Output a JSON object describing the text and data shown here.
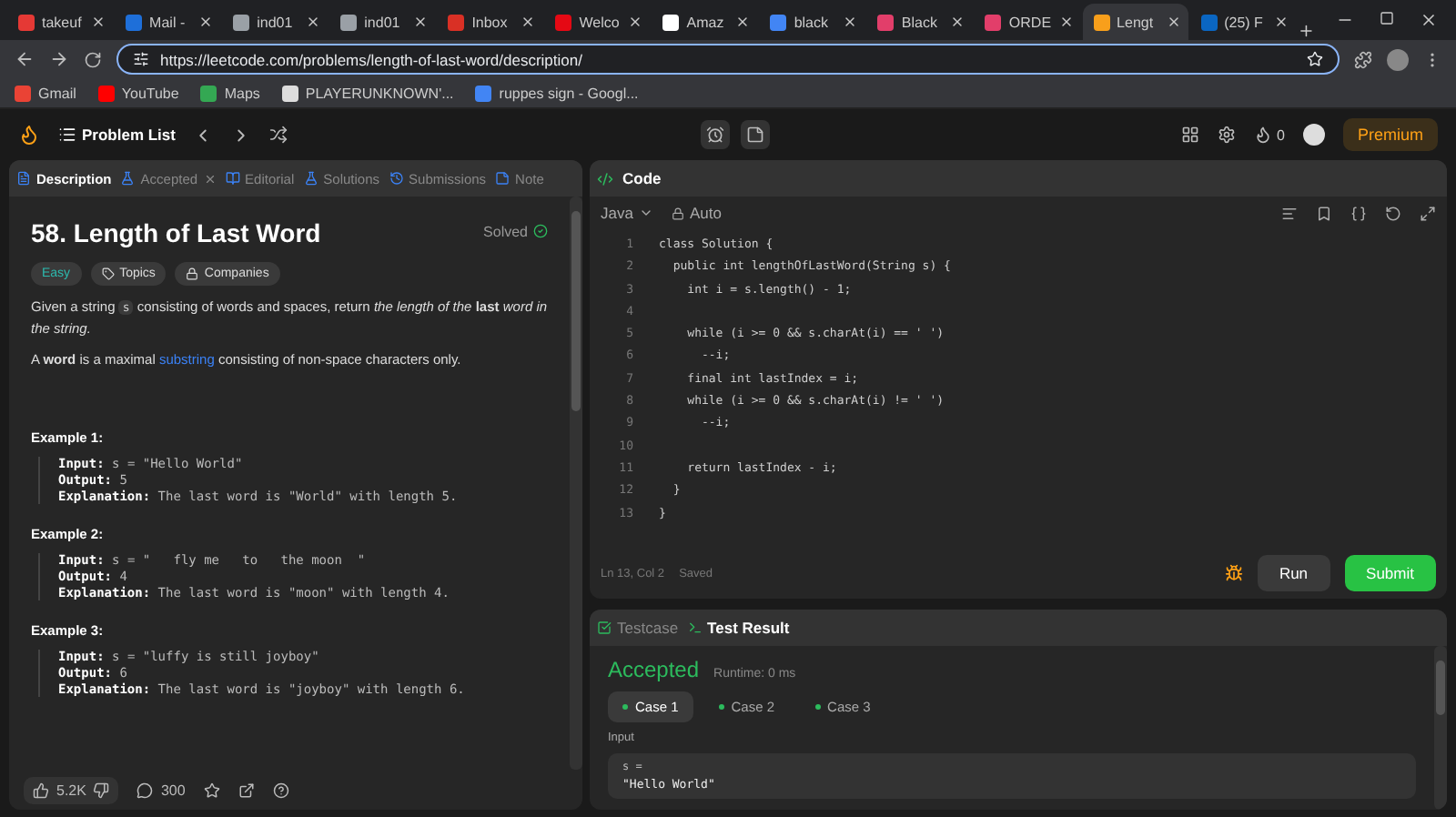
{
  "browser_tabs": [
    {
      "title": "takeuf",
      "color": "#e53935",
      "selected": false
    },
    {
      "title": "Mail -",
      "color": "#1e6fd9",
      "selected": false
    },
    {
      "title": "ind01",
      "color": "#9aa0a6",
      "selected": false
    },
    {
      "title": "ind01",
      "color": "#9aa0a6",
      "selected": false
    },
    {
      "title": "Inbox",
      "color": "#d93025",
      "selected": false
    },
    {
      "title": "Welco",
      "color": "#e50914",
      "selected": false
    },
    {
      "title": "Amaz",
      "color": "#ffffff",
      "selected": false
    },
    {
      "title": "black",
      "color": "#4285f4",
      "selected": false
    },
    {
      "title": "Black",
      "color": "#e23e6a",
      "selected": false
    },
    {
      "title": "ORDE",
      "color": "#e23e6a",
      "selected": false
    },
    {
      "title": "Lengt",
      "color": "#f89f1b",
      "selected": true
    },
    {
      "title": "(25) F",
      "color": "#0a66c2",
      "selected": false
    }
  ],
  "address_bar": {
    "url": "https://leetcode.com/problems/length-of-last-word/description/"
  },
  "bookmarks": [
    {
      "label": "Gmail",
      "color": "#ea4335"
    },
    {
      "label": "YouTube",
      "color": "#ff0000"
    },
    {
      "label": "Maps",
      "color": "#34a853"
    },
    {
      "label": "PLAYERUNKNOWN'...",
      "color": "#dddddd"
    },
    {
      "label": "ruppes sign - Googl...",
      "color": "#4285f4"
    }
  ],
  "navbar": {
    "problem_list": "Problem List",
    "streak": "0",
    "premium": "Premium"
  },
  "description_panel": {
    "tabs": [
      {
        "label": "Description",
        "selected": true,
        "closable": false
      },
      {
        "label": "Accepted",
        "selected": false,
        "closable": true
      },
      {
        "label": "Editorial",
        "selected": false,
        "closable": false
      },
      {
        "label": "Solutions",
        "selected": false,
        "closable": false
      },
      {
        "label": "Submissions",
        "selected": false,
        "closable": false
      },
      {
        "label": "Note",
        "selected": false,
        "closable": false
      }
    ],
    "title": "58. Length of Last Word",
    "status": "Solved",
    "tags": [
      {
        "label": "Easy",
        "kind": "difficulty"
      },
      {
        "label": "Topics",
        "kind": "topics"
      },
      {
        "label": "Companies",
        "kind": "companies"
      }
    ],
    "paragraphs": [
      [
        {
          "kind": "text",
          "text": "Given a string "
        },
        {
          "kind": "code",
          "text": "s"
        },
        {
          "kind": "text",
          "text": " consisting of words and spaces, return *the length of the* **last** *word in the string.*"
        }
      ],
      [
        {
          "kind": "text",
          "text": "A **word** is a maximal "
        },
        {
          "kind": "link",
          "text": "substring"
        },
        {
          "kind": "text",
          "text": " consisting of non-space characters only."
        }
      ]
    ],
    "examples": [
      {
        "heading": "Example 1:",
        "input_label": "Input:",
        "output_label": "Output:",
        "explanation_label": "Explanation:",
        "input": "s = \"Hello World\"",
        "output": "5",
        "explanation": "The last word is \"World\" with length 5."
      },
      {
        "heading": "Example 2:",
        "input_label": "Input:",
        "output_label": "Output:",
        "explanation_label": "Explanation:",
        "input": "s = \"   fly me   to   the moon  \"",
        "output": "4",
        "explanation": "The last word is \"moon\" with length 4."
      },
      {
        "heading": "Example 3:",
        "input_label": "Input:",
        "output_label": "Output:",
        "explanation_label": "Explanation:",
        "input": "s = \"luffy is still joyboy\"",
        "output": "6",
        "explanation": "The last word is \"joyboy\" with length 6."
      }
    ],
    "likes": "5.2K",
    "comments": "300"
  },
  "code_panel": {
    "title": "Code",
    "language": "Java",
    "mode": "Auto",
    "lines": [
      {
        "number": "1",
        "code": "class Solution {"
      },
      {
        "number": "2",
        "code": "  public int lengthOfLastWord(String s) {"
      },
      {
        "number": "3",
        "code": "    int i = s.length() - 1;"
      },
      {
        "number": "4"
      },
      {
        "number": "5",
        "code": "    while (i >= 0 && s.charAt(i) == ' ')"
      },
      {
        "number": "6",
        "code": "      --i;"
      },
      {
        "number": "7",
        "code": "    final int lastIndex = i;"
      },
      {
        "number": "8",
        "code": "    while (i >= 0 && s.charAt(i) != ' ')"
      },
      {
        "number": "9",
        "code": "      --i;"
      },
      {
        "number": "10"
      },
      {
        "number": "11",
        "code": "    return lastIndex - i;"
      },
      {
        "number": "12",
        "code": "  }"
      },
      {
        "number": "13",
        "code": "}"
      }
    ],
    "cursor": "Ln 13, Col 2",
    "save_state": "Saved",
    "run": "Run",
    "submit": "Submit"
  },
  "result_panel": {
    "tabs": [
      {
        "label": "Testcase",
        "selected": false
      },
      {
        "label": "Test Result",
        "selected": true
      }
    ],
    "verdict": "Accepted",
    "runtime": "Runtime: 0 ms",
    "cases": [
      {
        "label": "Case 1",
        "selected": true
      },
      {
        "label": "Case 2",
        "selected": false
      },
      {
        "label": "Case 3",
        "selected": false
      }
    ],
    "input_label": "Input",
    "variable": "s =",
    "value": "\"Hello World\""
  }
}
